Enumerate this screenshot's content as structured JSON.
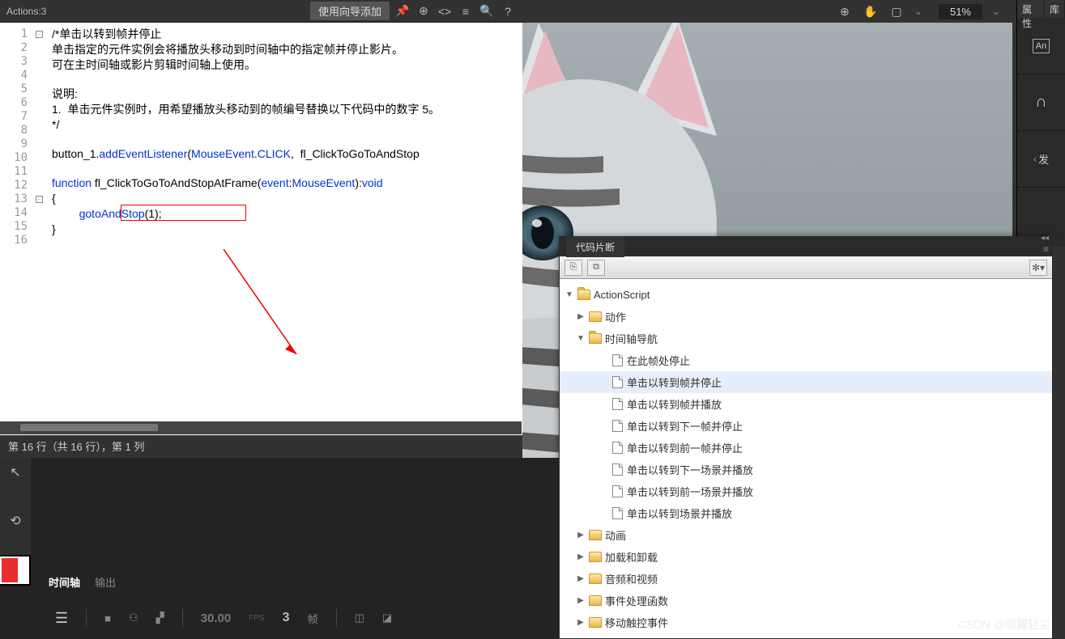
{
  "actions_bar": {
    "title": "Actions:3",
    "wizard": "使用向导添加"
  },
  "code": {
    "lines": [
      1,
      2,
      3,
      4,
      5,
      6,
      7,
      8,
      9,
      10,
      11,
      12,
      13,
      14,
      15,
      16
    ],
    "c1": "/*单击以转到帧并停止",
    "c2": "单击指定的元件实例会将播放头移动到时间轴中的指定帧并停止影片。",
    "c3": "可在主时间轴或影片剪辑时间轴上使用。",
    "c4": "说明:",
    "c5": "1.  单击元件实例时，用希望播放头移动到的帧编号替换以下代码中的数字 5。",
    "c6": "*/",
    "l10a": "button_1.",
    "l10b": "addEventListener",
    "l10c": "(",
    "l10d": "MouseEvent",
    "l10e": ".",
    "l10f": "CLICK",
    "l10g": ",  fl_ClickToGoToAndStop",
    "l12a": "function",
    "l12b": " fl_ClickToGoToAndStopAtFrame(",
    "l12c": "event",
    "l12d": ":",
    "l12e": "MouseEvent",
    "l12f": "):",
    "l12g": "void",
    "l13": "{",
    "l14a": "gotoAndStop",
    "l14b": "(1);",
    "l15": "}",
    "status": "第 16 行（共 16 行），第 1 列"
  },
  "canvas_tools": {
    "zoom": "51%"
  },
  "rside": {
    "t1": "属性",
    "t2": "库",
    "an": "An",
    "pub": "发"
  },
  "snippets": {
    "title": "代码片断",
    "root": "ActionScript",
    "f_actions": "动作",
    "f_timeline": "时间轴导航",
    "files": [
      "在此帧处停止",
      "单击以转到帧并停止",
      "单击以转到帧并播放",
      "单击以转到下一帧并停止",
      "单击以转到前一帧并停止",
      "单击以转到下一场景并播放",
      "单击以转到前一场景并播放",
      "单击以转到场景并播放"
    ],
    "f_anim": "动画",
    "f_load": "加载和卸载",
    "f_av": "音频和视频",
    "f_evt": "事件处理函数",
    "f_mobile": "移动触控事件"
  },
  "timeline": {
    "tab1": "时间轴",
    "tab2": "输出",
    "fps_val": "30.00",
    "fps_lbl": "FPS",
    "frame_val": "3",
    "frame_lbl": "帧"
  },
  "watermark": "CSDN @雨翼轻尘"
}
